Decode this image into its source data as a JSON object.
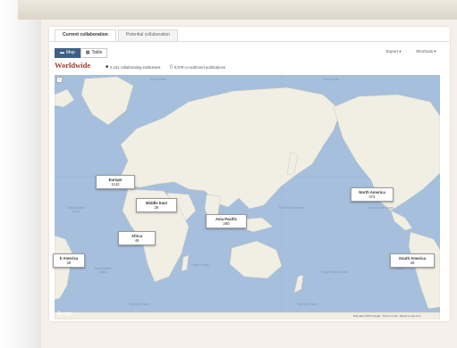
{
  "tabs": [
    "Current collaboration",
    "Potential collaboration"
  ],
  "view": {
    "map_label": "Map",
    "table_label": "Table"
  },
  "toolbar": {
    "export_label": "Export ▾",
    "shortcuts_label": "Shortcuts ▾"
  },
  "summary": {
    "title": "Worldwide",
    "institutions": "2,151 collaborating institutions",
    "publications": "6,979 co-authored publications"
  },
  "map": {
    "zoom_label": "−",
    "google_label": "Google",
    "footer": "Map data ©2013 Google · Terms of Use · Report a map error",
    "oceans": [
      "Arctic Ocean",
      "Arctic Ocean",
      "North Atlantic Ocean",
      "North Pacific Ocean",
      "North Pacific Ocean",
      "Indian Ocean",
      "South Atlantic Ocean",
      "South Pacific Ocean",
      "South Atlantic Ocean",
      "Southern Ocean",
      "Southern Ocean"
    ],
    "regions": [
      {
        "name": "Europe",
        "count": "1142"
      },
      {
        "name": "Middle East",
        "count": "26"
      },
      {
        "name": "Asia Pacific",
        "count": "280"
      },
      {
        "name": "Africa",
        "count": "46"
      },
      {
        "name": "North America",
        "count": "472"
      },
      {
        "name": "South America",
        "count": "28"
      },
      {
        "name": "h America",
        "count": "28"
      }
    ]
  },
  "colors": {
    "ocean": "#a5bfdd",
    "land": "#f1eee4",
    "title": "#a0392c",
    "active_button": "#3e5f84"
  }
}
